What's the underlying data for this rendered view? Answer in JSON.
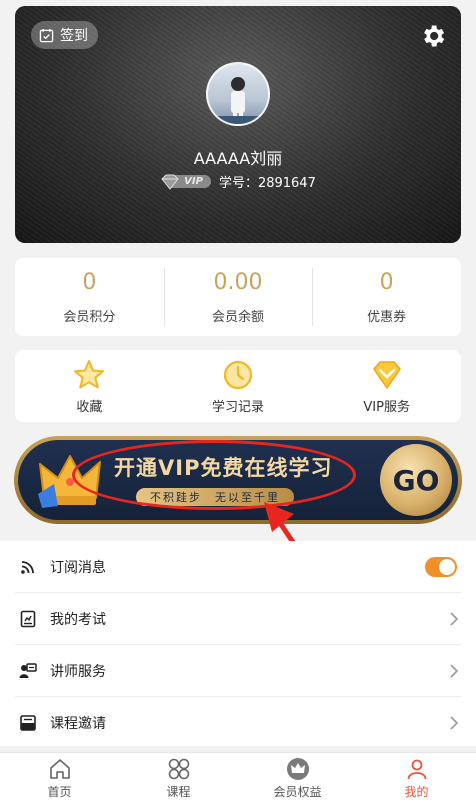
{
  "profile": {
    "checkin_label": "签到",
    "username": "AAAAA刘丽",
    "vip_tag": "VIP",
    "member_no": "学号：2891647"
  },
  "stats": [
    {
      "value": "0",
      "label": "会员积分"
    },
    {
      "value": "0.00",
      "label": "会员余额"
    },
    {
      "value": "0",
      "label": "优惠券"
    }
  ],
  "quick": [
    {
      "label": "收藏",
      "icon": "star-icon"
    },
    {
      "label": "学习记录",
      "icon": "clock-icon"
    },
    {
      "label": "VIP服务",
      "icon": "vip-diamond-icon"
    }
  ],
  "banner": {
    "title": "开通VIP免费在线学习",
    "subtitle": "不积跬步　无以至千里",
    "go_label": "GO"
  },
  "menu": [
    {
      "label": "订阅消息",
      "icon": "rss-icon",
      "toggle_on": true
    },
    {
      "label": "我的考试",
      "icon": "exam-icon"
    },
    {
      "label": "讲师服务",
      "icon": "lecturer-icon"
    },
    {
      "label": "课程邀请",
      "icon": "invite-icon"
    }
  ],
  "tabs": [
    {
      "label": "首页",
      "icon": "home-icon"
    },
    {
      "label": "课程",
      "icon": "courses-icon"
    },
    {
      "label": "会员权益",
      "icon": "crown-icon"
    },
    {
      "label": "我的",
      "icon": "person-icon",
      "active": true
    }
  ],
  "colors": {
    "accent_gold": "#c9a35c",
    "active_tab": "#e8553e",
    "toggle_on": "#f0902b",
    "annotation_red": "#e8261f"
  }
}
